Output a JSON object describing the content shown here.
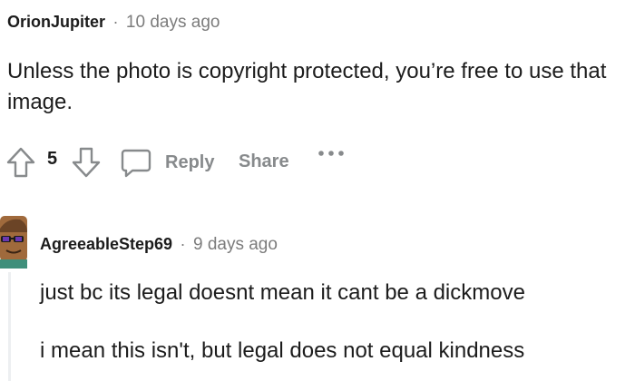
{
  "comment1": {
    "author": "OrionJupiter",
    "separator": "·",
    "time": "10 days ago",
    "body": "Unless the photo is copyright protected, you’re free to use that image.",
    "votes": "5",
    "actions": {
      "reply": "Reply",
      "share": "Share",
      "more": "···"
    }
  },
  "comment2": {
    "author": "AgreeableStep69",
    "separator": "·",
    "time": "9 days ago",
    "lines": [
      "just bc its legal doesnt mean it cant be a dickmove",
      "i mean this isn't, but legal does not equal kindness"
    ]
  },
  "colors": {
    "text": "#1c1c1c",
    "muted": "#7c7c7c",
    "action": "#878a8c",
    "thread_line": "#edeff1"
  },
  "icons": [
    "upvote-icon",
    "downvote-icon",
    "comment-icon",
    "more-icon",
    "avatar-icon"
  ]
}
